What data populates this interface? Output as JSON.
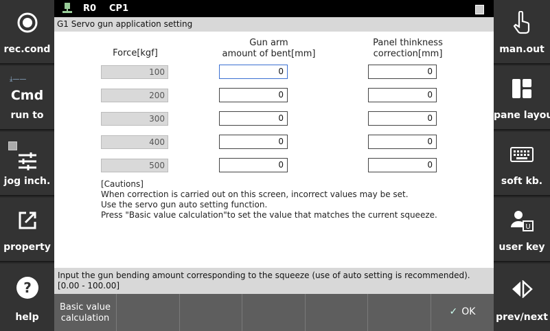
{
  "left_sidebar": [
    {
      "label": "rec.cond",
      "icon": "record-circle-icon"
    },
    {
      "label": "run to",
      "cmd": "Cmd",
      "icon": "cmd-arrow-icon"
    },
    {
      "label": "jog inch.",
      "icon": "sliders-icon"
    },
    {
      "label": "property",
      "icon": "external-edit-icon"
    },
    {
      "label": "help",
      "icon": "help-circle-icon"
    }
  ],
  "right_sidebar": [
    {
      "label": "man.out",
      "icon": "hand-pointer-icon"
    },
    {
      "label": "pane layout",
      "icon": "pane-layout-icon"
    },
    {
      "label": "soft kb.",
      "icon": "keyboard-icon"
    },
    {
      "label": "user key",
      "icon": "user-key-icon"
    },
    {
      "label": "prev/next",
      "icon": "prev-next-icon"
    }
  ],
  "status": {
    "robot": "R0",
    "program": "CP1"
  },
  "title": "G1  Servo gun application setting",
  "headers": {
    "force": "Force[kgf]",
    "gun_arm_1": "Gun arm",
    "gun_arm_2": "amount of bent[mm]",
    "panel_1": "Panel thinkness",
    "panel_2": "correction[mm]"
  },
  "rows": [
    {
      "force": "100",
      "bent": "0",
      "panel": "0"
    },
    {
      "force": "200",
      "bent": "0",
      "panel": "0"
    },
    {
      "force": "300",
      "bent": "0",
      "panel": "0"
    },
    {
      "force": "400",
      "bent": "0",
      "panel": "0"
    },
    {
      "force": "500",
      "bent": "0",
      "panel": "0"
    }
  ],
  "cautions": [
    "[Cautions]",
    "When correction is carried out on this screen, incorrect values may be set.",
    "Use the servo gun auto setting function.",
    "Press \"Basic value calculation\"to set the value that matches the current squeeze."
  ],
  "message": {
    "line1": "Input the gun bending amount corresponding to the squeeze (use of auto setting is recommended).",
    "line2": "[0.00 - 100.00]"
  },
  "fkeys": {
    "basic_line1": "Basic value",
    "basic_line2": "calculation",
    "ok": "OK"
  }
}
